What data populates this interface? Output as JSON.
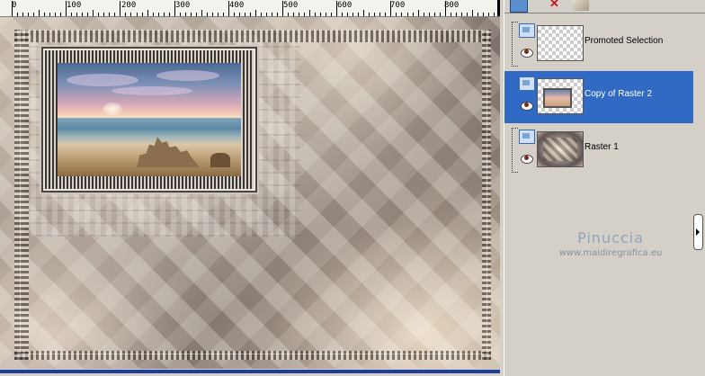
{
  "ruler": {
    "labels": [
      "0",
      "100",
      "200",
      "300",
      "400",
      "500",
      "600",
      "700",
      "800"
    ]
  },
  "layers_panel": {
    "toolbar": {
      "icons": [
        "new-layer-icon",
        "delete-layer-icon",
        "layer-styles-icon"
      ]
    },
    "layers": [
      {
        "name": "Promoted Selection",
        "selected": false,
        "visible": true
      },
      {
        "name": "Copy of Raster 2",
        "selected": true,
        "visible": true
      },
      {
        "name": "Raster 1",
        "selected": false,
        "visible": true
      }
    ],
    "selection_color": "#316ac5"
  },
  "watermark": {
    "title": "Pinuccia",
    "url": "www.maidiregrafica.eu"
  }
}
